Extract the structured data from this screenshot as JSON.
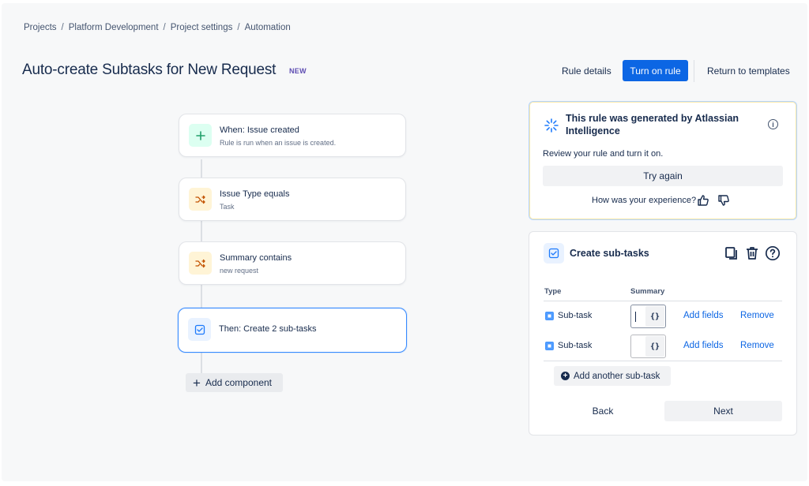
{
  "breadcrumb": {
    "items": [
      "Projects",
      "Platform Development",
      "Project settings",
      "Automation"
    ],
    "separator": "/"
  },
  "header": {
    "title": "Auto-create Subtasks for New Request",
    "badge": "NEW",
    "rule_details": "Rule details",
    "turn_on": "Turn on rule",
    "return_templates": "Return to templates"
  },
  "flow": {
    "steps": [
      {
        "title": "When: Issue created",
        "subtitle": "Rule is run when an issue is created.",
        "icon": "plus-icon"
      },
      {
        "title": "Issue Type equals",
        "subtitle": "Task",
        "icon": "shuffle-icon"
      },
      {
        "title": "Summary contains",
        "subtitle": "new request",
        "icon": "shuffle-icon"
      },
      {
        "title": "Then: Create 2 sub-tasks",
        "subtitle": "",
        "icon": "checkbox-icon"
      }
    ],
    "add_component": "Add component"
  },
  "ai_panel": {
    "title": "This rule was generated by Atlassian Intelligence",
    "subtitle": "Review your rule and turn it on.",
    "try_again": "Try again",
    "experience": "How was your experience?"
  },
  "create_panel": {
    "title": "Create sub-tasks",
    "col_type": "Type",
    "col_summary": "Summary",
    "rows": [
      {
        "type": "Sub-task",
        "summary_value": "",
        "add_fields": "Add fields",
        "remove": "Remove"
      },
      {
        "type": "Sub-task",
        "summary_value": "",
        "add_fields": "Add fields",
        "remove": "Remove"
      }
    ],
    "brace": "{}",
    "add_another": "Add another sub-task",
    "back": "Back",
    "next": "Next"
  },
  "colors": {
    "primary": "#0c66e4",
    "badge": "#5e4db2",
    "selected_border": "#388bff"
  }
}
